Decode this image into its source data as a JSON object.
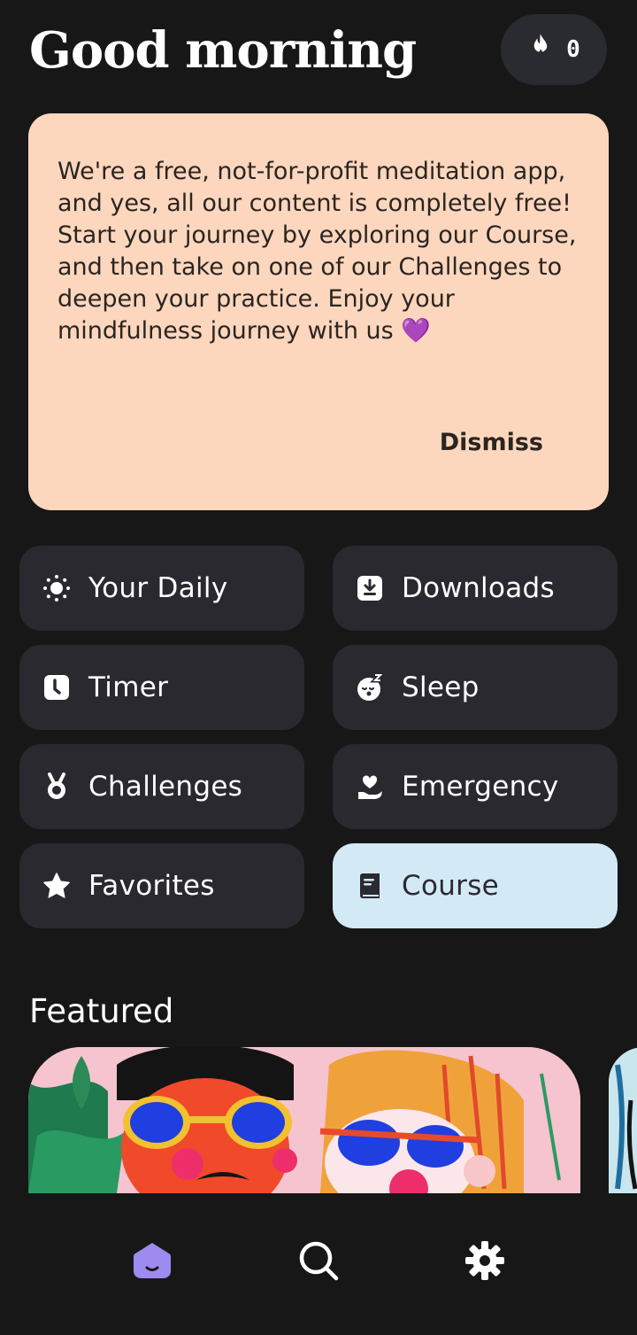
{
  "header": {
    "greeting": "Good morning",
    "streak_count": "0",
    "streak_icon": "flame-icon"
  },
  "notice": {
    "text": "We're a free, not-for-profit meditation app, and yes, all our content is completely free! Start your journey by exploring our Course, and then take on one of our Challenges to deepen your practice. Enjoy your mindfulness journey with us",
    "emoji": "💜",
    "dismiss_label": "Dismiss"
  },
  "tiles": [
    {
      "label": "Your Daily",
      "icon": "sun-icon"
    },
    {
      "label": "Downloads",
      "icon": "download-icon"
    },
    {
      "label": "Timer",
      "icon": "timer-icon"
    },
    {
      "label": "Sleep",
      "icon": "sleep-icon"
    },
    {
      "label": "Challenges",
      "icon": "medal-icon"
    },
    {
      "label": "Emergency",
      "icon": "heart-hand-icon"
    },
    {
      "label": "Favorites",
      "icon": "star-icon"
    },
    {
      "label": "Course",
      "icon": "book-icon",
      "active": true
    }
  ],
  "featured": {
    "title": "Featured"
  },
  "nav": [
    {
      "icon": "home-face-icon",
      "active": true
    },
    {
      "icon": "search-icon"
    },
    {
      "icon": "gear-icon"
    }
  ],
  "colors": {
    "background": "#171717",
    "tile": "#29292f",
    "tile_active": "#d3eaf6",
    "notice": "#fdd7bd",
    "accent": "#9d8bf0"
  }
}
